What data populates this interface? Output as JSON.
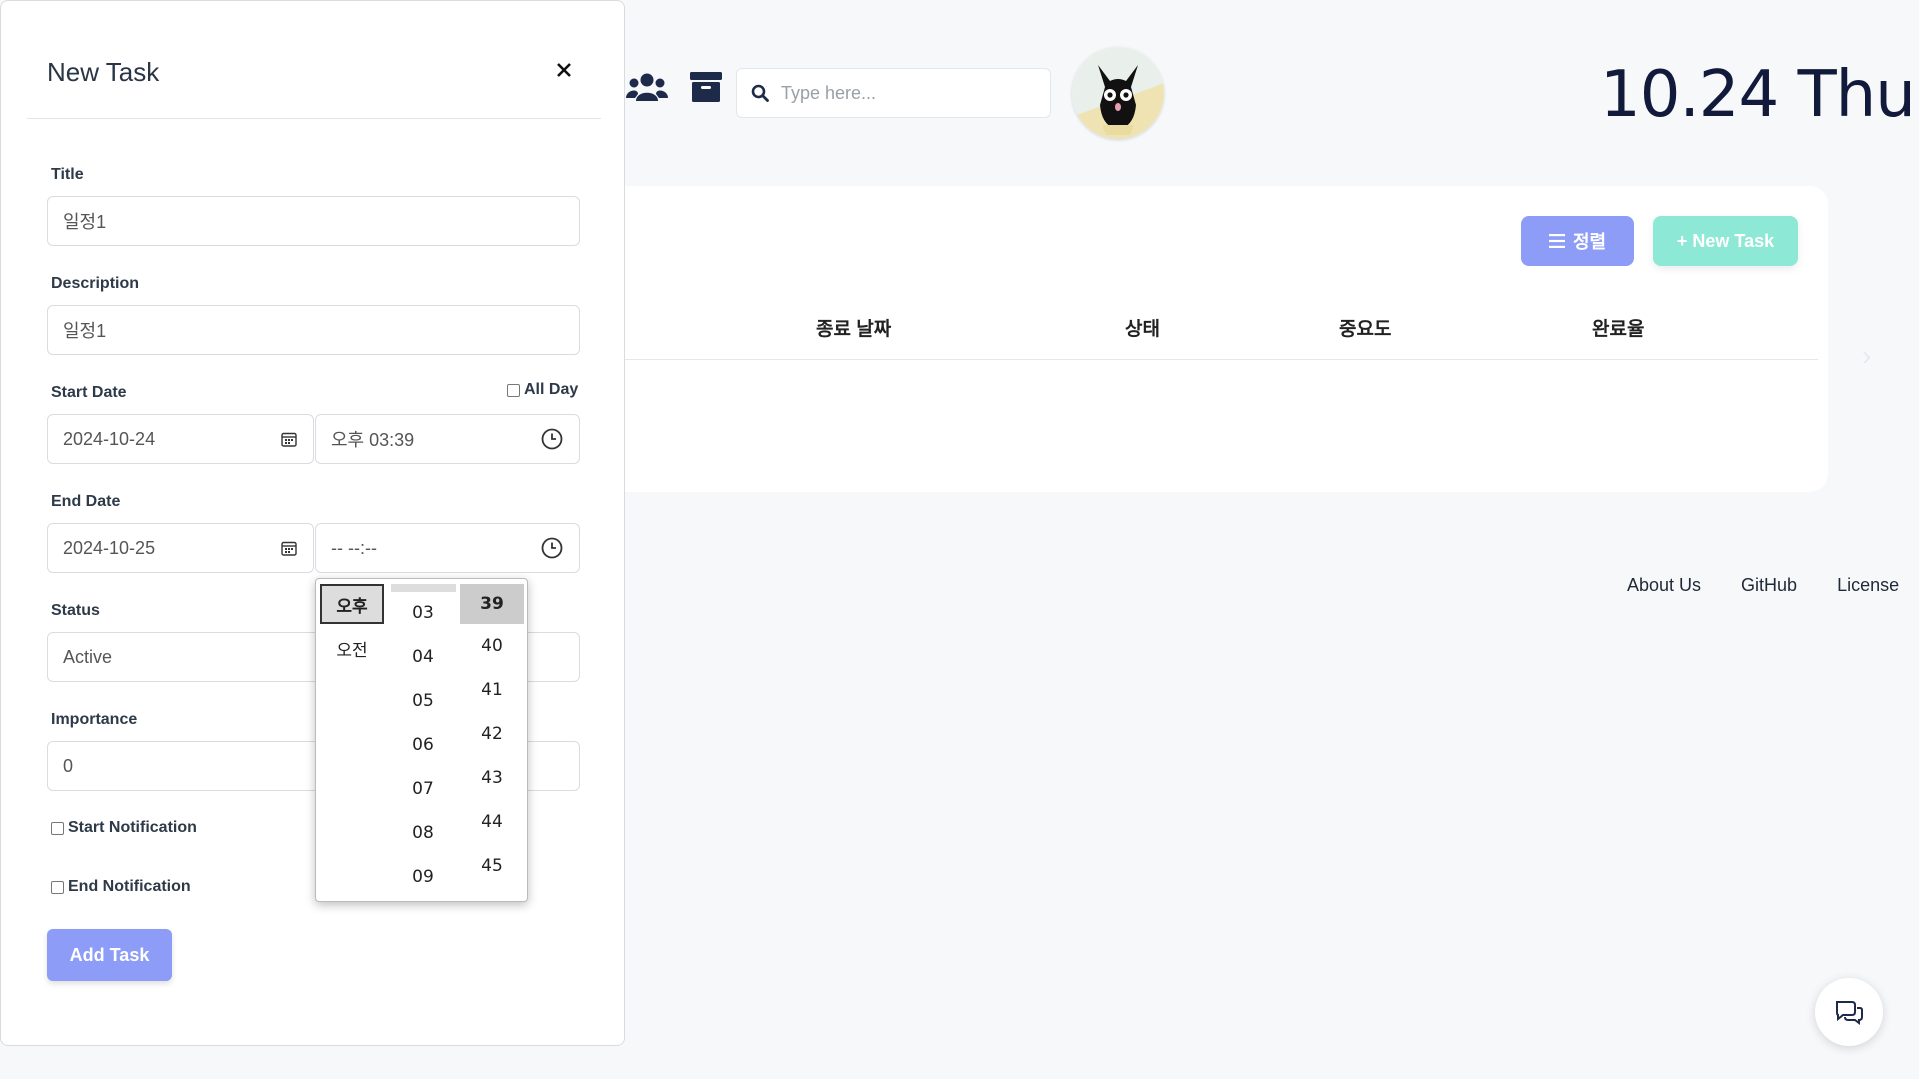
{
  "header": {
    "search_placeholder": "Type here...",
    "date_text": "10.24  Thu",
    "icons": [
      "users-icon",
      "archive-icon",
      "search-icon"
    ]
  },
  "main": {
    "sort_button": "정렬",
    "new_task_button": "+ New Task",
    "columns": [
      "종료 날짜",
      "상태",
      "중요도",
      "완료율"
    ]
  },
  "footer": {
    "links": [
      "About Us",
      "GitHub",
      "License"
    ]
  },
  "modal": {
    "title": "New Task",
    "title_label": "Title",
    "title_value": "일정1",
    "description_label": "Description",
    "description_value": "일정1",
    "start_date_label": "Start Date",
    "all_day_label": "All Day",
    "start_date_value": "2024-10-24",
    "start_time_value": "오후 03:39",
    "end_date_label": "End Date",
    "end_date_value": "2024-10-25",
    "end_time_value": "-- --:--",
    "status_label": "Status",
    "status_value": "Active",
    "importance_label": "Importance",
    "importance_value": "0",
    "start_notification_label": "Start Notification",
    "end_notification_label": "End Notification",
    "add_button": "Add Task"
  },
  "time_picker": {
    "ampm": [
      "오후",
      "오전"
    ],
    "hours": [
      "03",
      "04",
      "05",
      "06",
      "07",
      "08",
      "09"
    ],
    "minutes": [
      "39",
      "40",
      "41",
      "42",
      "43",
      "44",
      "45"
    ]
  },
  "colors": {
    "primary": "#8c9cf7",
    "accent": "#8ee8d6",
    "date_text": "#111a3a"
  }
}
